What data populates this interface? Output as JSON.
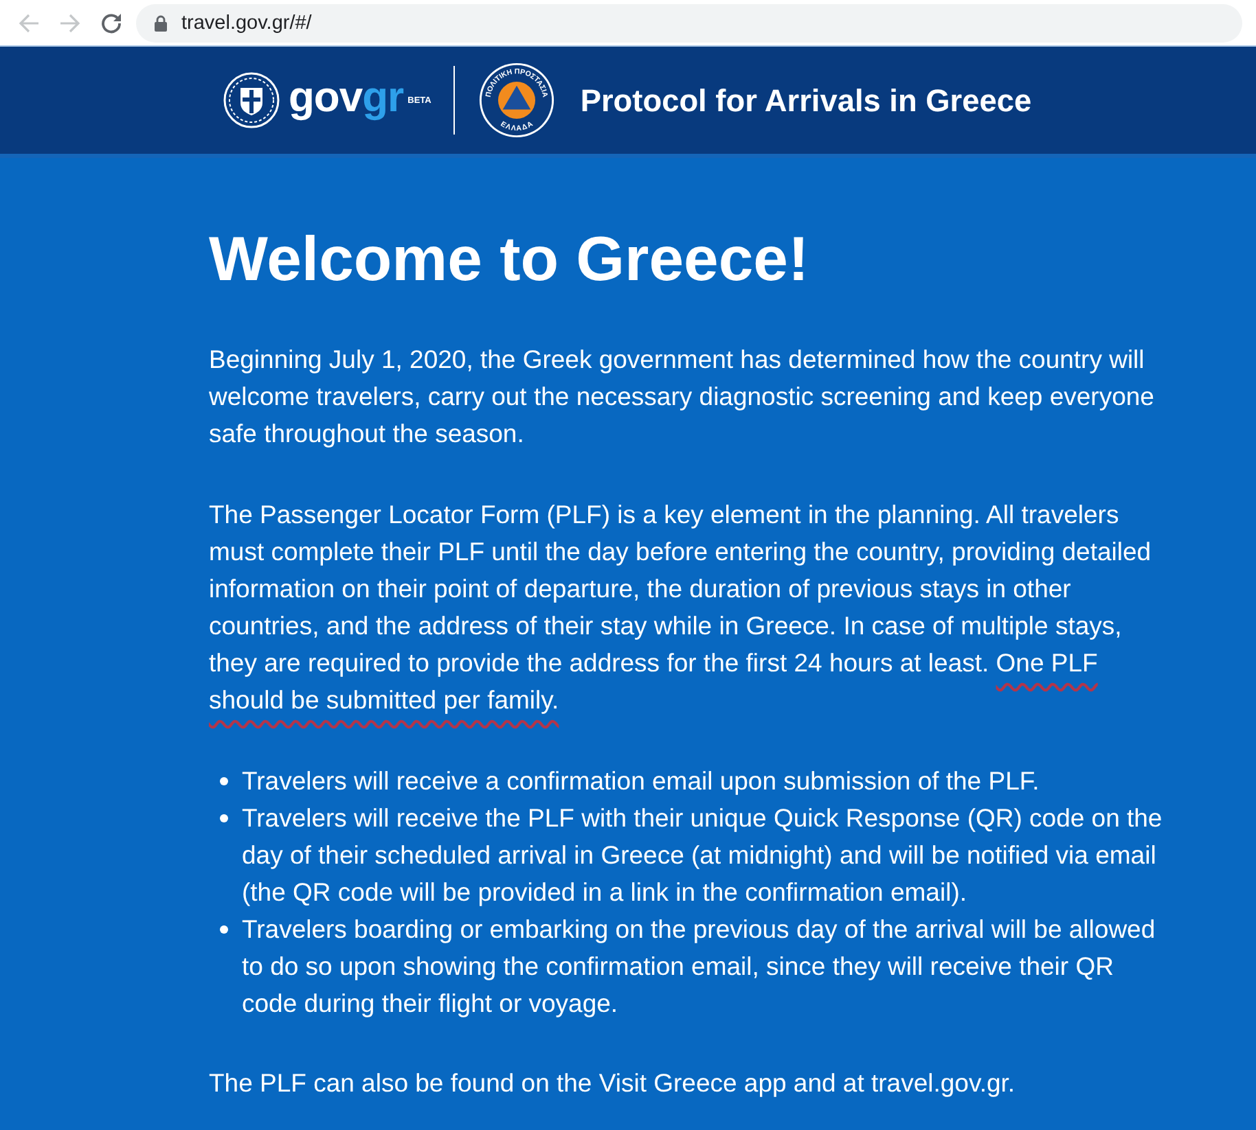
{
  "browser": {
    "back_enabled": false,
    "forward_enabled": false,
    "url": "travel.gov.gr/#/"
  },
  "header": {
    "logo": {
      "parts": [
        {
          "text": "gov",
          "kind": "plain"
        },
        {
          "text": "gr",
          "kind": "accent"
        }
      ],
      "badge": "BETA"
    },
    "seal": {
      "top_text": "ΠΟΛΙΤΙΚΗ ΠΡΟΣΤΑΣΙΑ",
      "bottom_text": "ΕΛΛΑΔΑ"
    },
    "title": "Protocol for Arrivals in Greece"
  },
  "main": {
    "heading": "Welcome to Greece!",
    "paragraphs": [
      {
        "segments": [
          {
            "text": "Beginning July 1, 2020, the Greek government has determined how the country will welcome travelers, carry out the necessary diagnostic screening and keep everyone safe throughout the season.",
            "pen_underline": false
          }
        ]
      },
      {
        "segments": [
          {
            "text": "The Passenger Locator Form (PLF) is a key element in the planning. All travelers must complete their PLF until the day before entering the country, providing detailed information on their point of departure, the duration of previous stays in other countries, and the address of their stay while in Greece. In case of multiple stays, they are required to provide the address for the first 24 hours at least.",
            "pen_underline": false
          },
          {
            "text": "One PLF should be submitted per family.",
            "pen_underline": true
          }
        ]
      }
    ],
    "bullets": [
      "Travelers will receive a confirmation email upon submission of the PLF.",
      "Travelers will receive the PLF with their unique Quick Response (QR) code on the day of their scheduled arrival in Greece (at midnight) and will be notified via email (the QR code will be provided in a link in the confirmation email).",
      "Travelers boarding or embarking on the previous day of the arrival will be allowed to do so upon showing the confirmation email, since they will receive their QR code during their flight or voyage."
    ],
    "closing": "The PLF can also be found on the Visit Greece app and at travel.gov.gr."
  }
}
